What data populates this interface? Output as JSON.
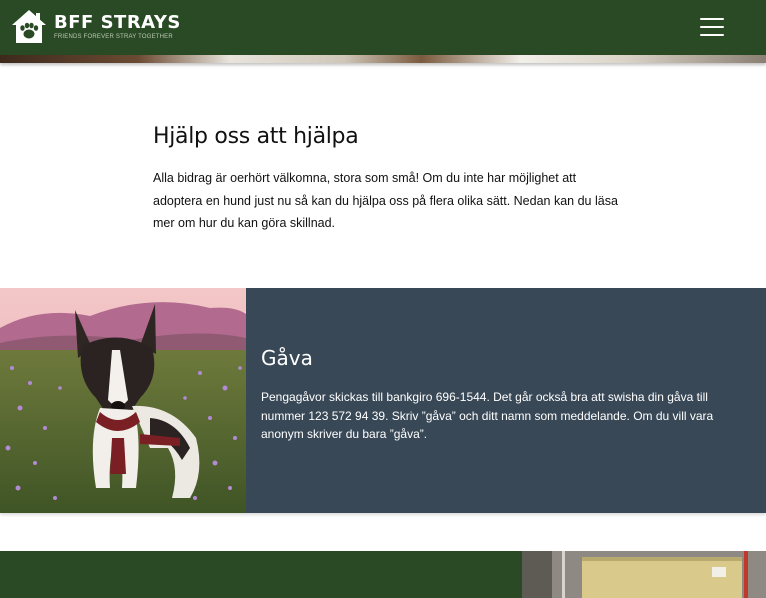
{
  "header": {
    "logo_title": "BFF STRAYS",
    "logo_tagline": "Friends forever stray together",
    "menu_icon": "hamburger-menu-icon",
    "background": "#2a4a25"
  },
  "intro": {
    "title": "Hjälp oss att hjälpa",
    "body": "Alla bidrag är oerhört välkomna, stora som små! Om du inte har möjlighet att adoptera en hund just nu så kan du hjälpa oss på flera olika sätt. Nedan kan du läsa mer om hur du kan göra skillnad."
  },
  "gift": {
    "title": "Gåva",
    "body": "Pengagåvor skickas till bankgiro 696-1544. Det går också bra att swisha din gåva till nummer 123 572 94 39. Skriv ”gåva” och ditt namn som meddelande. Om du vill vara anonym skriver du bara ”gåva”.",
    "background": "#384856",
    "photo": "dog-in-flower-field-photo"
  },
  "bottom": {
    "background": "#2a4a25",
    "photo": "gate-photo"
  }
}
